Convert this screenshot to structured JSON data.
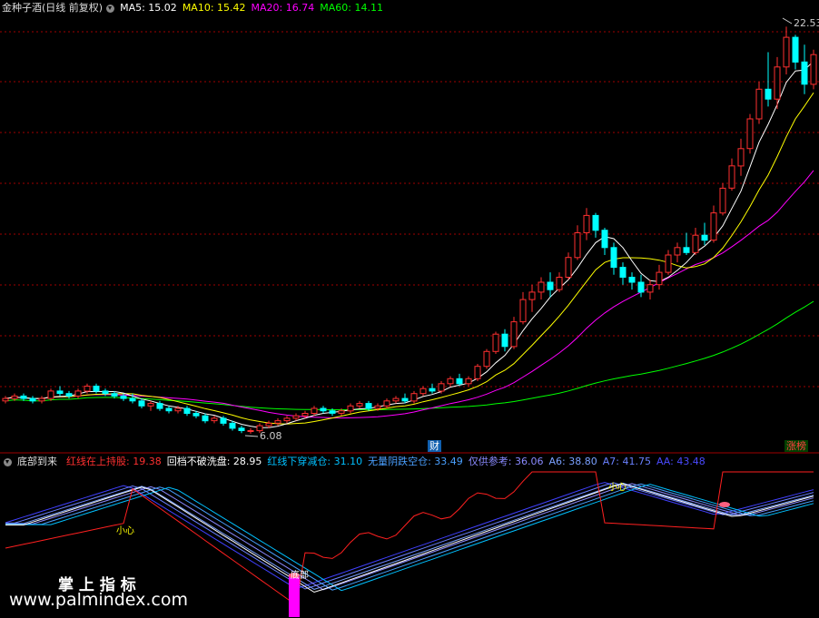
{
  "header": {
    "title": "金种子酒(日线 前复权)",
    "ma5": "MA5: 15.02",
    "ma10": "MA10: 15.42",
    "ma20": "MA20: 16.74",
    "ma60": "MA60: 14.11",
    "colors": {
      "ma5": "#ffffff",
      "ma10": "#ffff00",
      "ma20": "#ff00ff",
      "ma60": "#00ff00"
    }
  },
  "price_panel": {
    "high_label": "22.53",
    "low_label": "6.08",
    "tag_cai": "财",
    "tag_zhangting": "涨榜"
  },
  "indicator": {
    "name": "底部到来",
    "items": [
      {
        "label": "红线在上持股:",
        "value": "19.38",
        "color": "#ff3030"
      },
      {
        "label": "回档不破洗盘:",
        "value": "28.95",
        "color": "#ffffff"
      },
      {
        "label": "红线下穿减仓:",
        "value": "31.10",
        "color": "#00c0ff"
      },
      {
        "label": "无量阴跌空仓:",
        "value": "33.49",
        "color": "#4aa0ff"
      },
      {
        "label": "仅供参考:",
        "value": "36.06",
        "color": "#8a8aff"
      },
      {
        "label": "A6:",
        "value": "38.80",
        "color": "#7aa0ff"
      },
      {
        "label": "A7:",
        "value": "41.75",
        "color": "#6a80ff"
      },
      {
        "label": "AA:",
        "value": "43.48",
        "color": "#4a4aff"
      }
    ],
    "marker_xin_1": "小心",
    "marker_xin_2": "小心",
    "marker_bottom": "底部"
  },
  "watermark": {
    "line1": "掌 上 指 标",
    "line2": "www.palmindex.com"
  },
  "chart_data": {
    "type": "line",
    "title": "金种子酒(日线 前复权)",
    "series": [
      {
        "name": "MA5",
        "last": 15.02
      },
      {
        "name": "MA10",
        "last": 15.42
      },
      {
        "name": "MA20",
        "last": 16.74
      },
      {
        "name": "MA60",
        "last": 14.11
      }
    ],
    "candles": [
      [
        7.4,
        7.6,
        7.3,
        7.5
      ],
      [
        7.5,
        7.7,
        7.4,
        7.6
      ],
      [
        7.6,
        7.7,
        7.4,
        7.5
      ],
      [
        7.5,
        7.6,
        7.3,
        7.4
      ],
      [
        7.4,
        7.6,
        7.3,
        7.5
      ],
      [
        7.5,
        7.9,
        7.4,
        7.8
      ],
      [
        7.8,
        8.0,
        7.6,
        7.7
      ],
      [
        7.7,
        7.8,
        7.5,
        7.6
      ],
      [
        7.6,
        7.9,
        7.5,
        7.8
      ],
      [
        7.8,
        8.1,
        7.7,
        8.0
      ],
      [
        8.0,
        8.1,
        7.7,
        7.8
      ],
      [
        7.8,
        7.9,
        7.6,
        7.7
      ],
      [
        7.7,
        7.8,
        7.5,
        7.6
      ],
      [
        7.6,
        7.7,
        7.4,
        7.5
      ],
      [
        7.5,
        7.7,
        7.3,
        7.4
      ],
      [
        7.4,
        7.5,
        7.1,
        7.2
      ],
      [
        7.2,
        7.4,
        7.0,
        7.3
      ],
      [
        7.3,
        7.4,
        7.0,
        7.1
      ],
      [
        7.1,
        7.2,
        6.9,
        7.0
      ],
      [
        7.0,
        7.2,
        6.9,
        7.1
      ],
      [
        7.1,
        7.2,
        6.8,
        6.9
      ],
      [
        6.9,
        7.0,
        6.7,
        6.8
      ],
      [
        6.8,
        6.9,
        6.5,
        6.6
      ],
      [
        6.6,
        6.8,
        6.5,
        6.7
      ],
      [
        6.7,
        6.8,
        6.4,
        6.5
      ],
      [
        6.5,
        6.6,
        6.2,
        6.3
      ],
      [
        6.3,
        6.4,
        6.1,
        6.2
      ],
      [
        6.2,
        6.3,
        6.08,
        6.2
      ],
      [
        6.2,
        6.5,
        6.1,
        6.4
      ],
      [
        6.4,
        6.6,
        6.3,
        6.5
      ],
      [
        6.5,
        6.7,
        6.4,
        6.6
      ],
      [
        6.6,
        6.8,
        6.5,
        6.7
      ],
      [
        6.7,
        6.9,
        6.6,
        6.8
      ],
      [
        6.8,
        7.0,
        6.7,
        6.9
      ],
      [
        6.9,
        7.2,
        6.8,
        7.1
      ],
      [
        7.1,
        7.2,
        6.9,
        7.0
      ],
      [
        7.0,
        7.1,
        6.8,
        6.9
      ],
      [
        6.9,
        7.1,
        6.8,
        7.0
      ],
      [
        7.0,
        7.3,
        6.9,
        7.2
      ],
      [
        7.2,
        7.4,
        7.1,
        7.3
      ],
      [
        7.3,
        7.4,
        7.0,
        7.1
      ],
      [
        7.1,
        7.3,
        7.0,
        7.2
      ],
      [
        7.2,
        7.5,
        7.1,
        7.4
      ],
      [
        7.4,
        7.6,
        7.3,
        7.5
      ],
      [
        7.5,
        7.7,
        7.3,
        7.4
      ],
      [
        7.4,
        7.8,
        7.3,
        7.7
      ],
      [
        7.7,
        8.0,
        7.6,
        7.9
      ],
      [
        7.9,
        8.1,
        7.7,
        7.8
      ],
      [
        7.8,
        8.2,
        7.7,
        8.1
      ],
      [
        8.1,
        8.4,
        8.0,
        8.3
      ],
      [
        8.3,
        8.5,
        8.0,
        8.1
      ],
      [
        8.1,
        8.4,
        8.0,
        8.3
      ],
      [
        8.3,
        8.9,
        8.2,
        8.8
      ],
      [
        8.8,
        9.5,
        8.7,
        9.4
      ],
      [
        9.4,
        10.2,
        9.3,
        10.1
      ],
      [
        10.1,
        10.3,
        9.4,
        9.6
      ],
      [
        9.6,
        10.8,
        9.5,
        10.6
      ],
      [
        10.6,
        11.8,
        10.5,
        11.5
      ],
      [
        11.5,
        12.1,
        11.0,
        11.8
      ],
      [
        11.8,
        12.4,
        11.5,
        12.2
      ],
      [
        12.2,
        12.6,
        11.6,
        11.9
      ],
      [
        11.9,
        12.6,
        11.8,
        12.4
      ],
      [
        12.4,
        13.4,
        12.3,
        13.2
      ],
      [
        13.2,
        14.5,
        13.1,
        14.2
      ],
      [
        14.2,
        15.2,
        13.9,
        14.9
      ],
      [
        14.9,
        15.0,
        14.0,
        14.3
      ],
      [
        14.3,
        14.4,
        13.3,
        13.6
      ],
      [
        13.6,
        13.8,
        12.5,
        12.8
      ],
      [
        12.8,
        13.0,
        12.1,
        12.4
      ],
      [
        12.4,
        12.6,
        11.9,
        12.2
      ],
      [
        12.2,
        12.5,
        11.6,
        11.8
      ],
      [
        11.8,
        12.3,
        11.5,
        12.1
      ],
      [
        12.1,
        12.9,
        11.9,
        12.6
      ],
      [
        12.6,
        13.5,
        12.5,
        13.3
      ],
      [
        13.3,
        13.8,
        13.0,
        13.6
      ],
      [
        13.6,
        14.2,
        13.3,
        13.4
      ],
      [
        13.4,
        14.4,
        13.3,
        14.1
      ],
      [
        14.1,
        14.6,
        13.7,
        13.9
      ],
      [
        13.9,
        15.3,
        13.8,
        15.0
      ],
      [
        15.0,
        16.2,
        14.9,
        16.0
      ],
      [
        16.0,
        17.2,
        15.9,
        16.9
      ],
      [
        16.9,
        18.0,
        16.5,
        17.6
      ],
      [
        17.6,
        19.0,
        17.4,
        18.8
      ],
      [
        18.8,
        20.3,
        18.6,
        20.0
      ],
      [
        20.0,
        21.5,
        19.3,
        19.6
      ],
      [
        19.6,
        21.3,
        19.2,
        20.9
      ],
      [
        20.9,
        22.53,
        20.6,
        22.1
      ],
      [
        22.1,
        22.2,
        20.8,
        21.1
      ],
      [
        21.1,
        21.8,
        19.8,
        20.2
      ],
      [
        20.2,
        21.6,
        20.0,
        21.4
      ]
    ]
  }
}
